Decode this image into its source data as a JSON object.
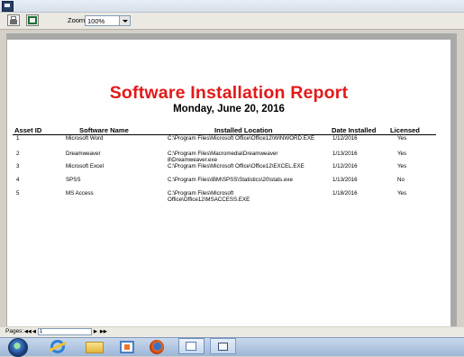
{
  "toolbar": {
    "print_icon": "printer-icon",
    "export_icon": "export-icon",
    "zoom_label": "Zoom",
    "zoom_value": "100%"
  },
  "report": {
    "title": "Software Installation  Report",
    "date": "Monday, June 20, 2016",
    "title_color": "#e31919",
    "columns": [
      "Asset ID",
      "Software Name",
      "Installed Location",
      "Date Installed",
      "Licensed"
    ],
    "rows": [
      {
        "id": "1",
        "name": "Microsoft Word",
        "loc1": "C:\\Program Files\\Microsoft Office\\Office12\\WINWORD.EXE",
        "loc2": "",
        "date": "1/12/2016",
        "licensed": "Yes"
      },
      {
        "id": "2",
        "name": "Dreamweaver",
        "loc1": "C:\\Program Files\\Macromedia\\Dreamweaver",
        "loc2": "8\\Dreamweaver.exe",
        "date": "1/13/2016",
        "licensed": "Yes"
      },
      {
        "id": "3",
        "name": "Microsoft Excel",
        "loc1": "C:\\Program Files\\Microsoft Office\\Office12\\EXCEL.EXE",
        "loc2": "",
        "date": "1/12/2016",
        "licensed": "Yes"
      },
      {
        "id": "4",
        "name": "SPSS",
        "loc1": "C:\\Program Files\\IBM\\SPSS\\Statistics\\20\\stats.exe",
        "loc2": "",
        "date": "1/13/2016",
        "licensed": "No"
      },
      {
        "id": "5",
        "name": "MS Access",
        "loc1": "C:\\Program Files\\Microsoft",
        "loc2": "Office\\Office12\\MSACCESS.EXE",
        "date": "1/18/2016",
        "licensed": "Yes"
      }
    ]
  },
  "status": {
    "pages_label": "Pages:",
    "first": "◀◀",
    "prev": "◀",
    "page_value": "1",
    "next": "▶",
    "last": "▶▶"
  },
  "taskbar": {
    "items": [
      "start-orb",
      "internet-explorer-icon",
      "folder-icon",
      "media-player-icon",
      "firefox-icon",
      "report-app-icon",
      "window-icon"
    ]
  }
}
